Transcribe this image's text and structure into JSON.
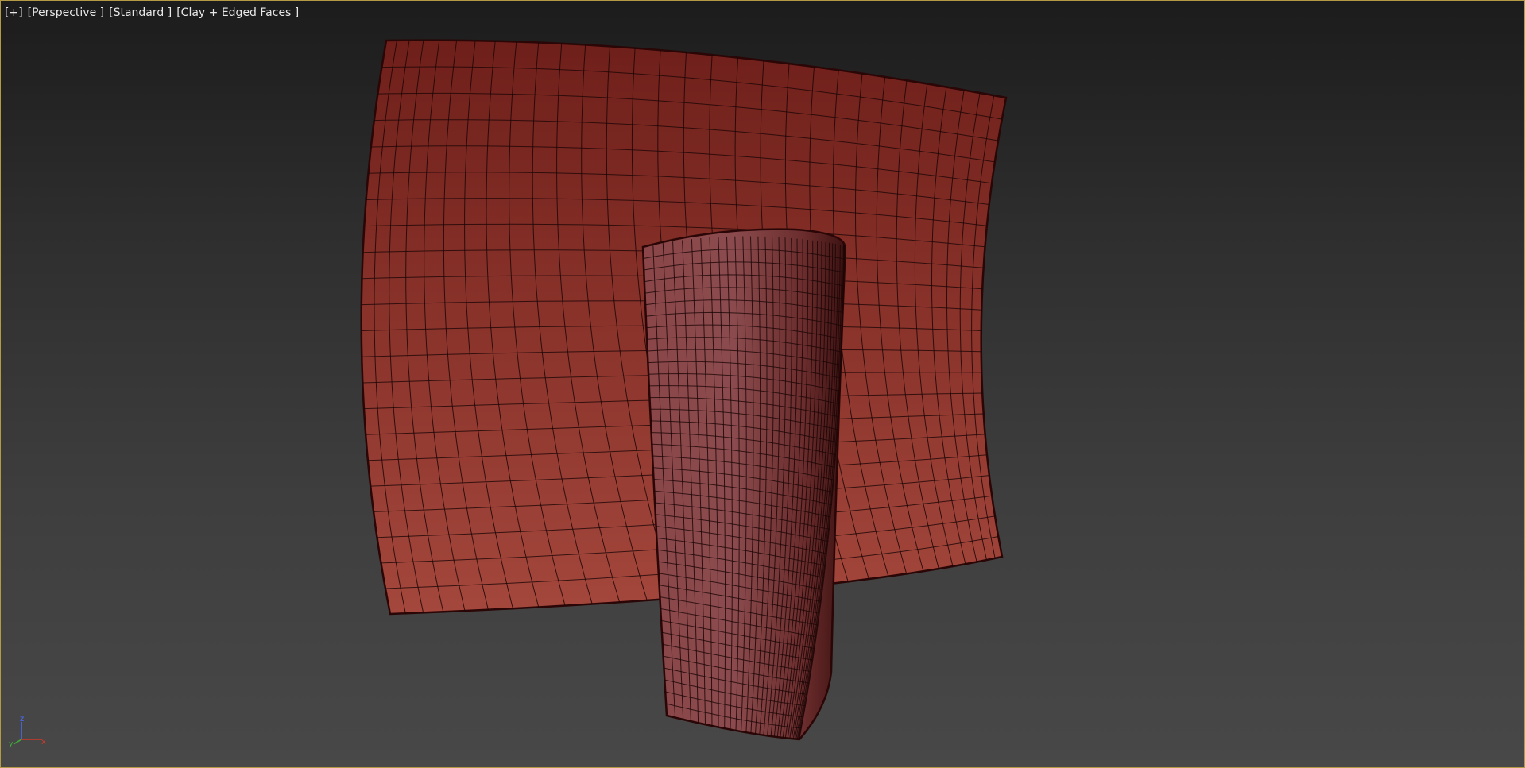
{
  "viewport": {
    "menu_plus": "[+]",
    "view": "[Perspective ]",
    "shading_preset": "[Standard ]",
    "display_mode": "[Clay + Edged Faces ]",
    "border_color": "#b59a45"
  },
  "objects": {
    "plane_color": "#8f3a30",
    "cylinder_color": "#9a4a48",
    "wire_color": "#1c0606"
  },
  "gizmo": {
    "z_label": "z",
    "x_label": "x",
    "y_label": "y",
    "z_color": "#4a6cff",
    "x_color": "#d03a2a",
    "y_color": "#3fae3a"
  }
}
